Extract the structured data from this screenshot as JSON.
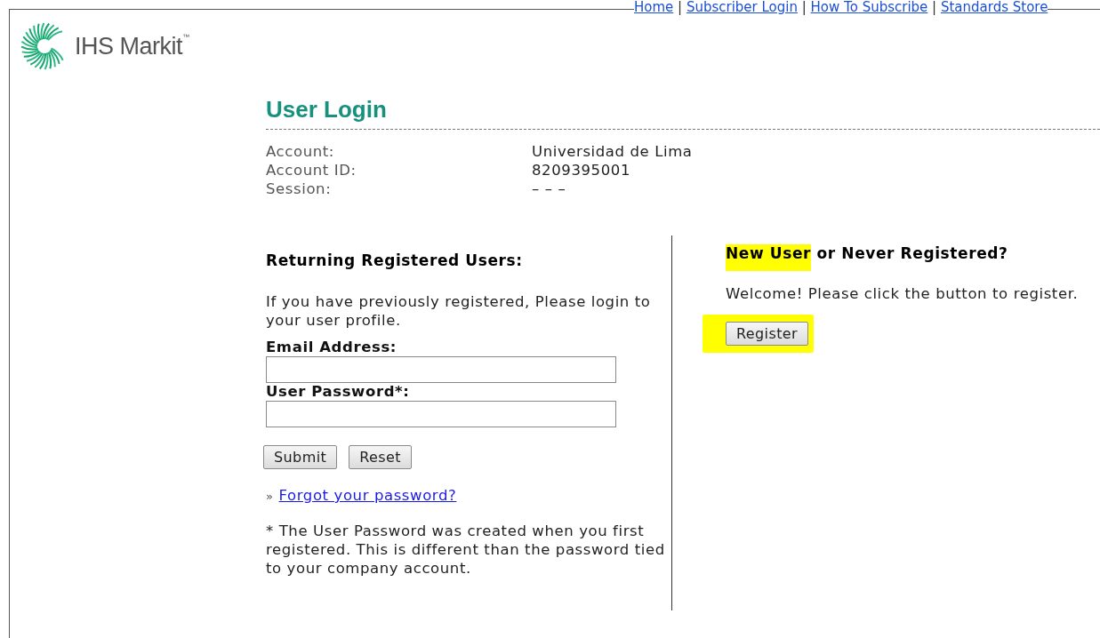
{
  "top_nav": {
    "links": [
      "Home",
      "Subscriber Login",
      "How To Subscribe",
      "Standards Store"
    ],
    "separator": "|"
  },
  "logo": {
    "text": "IHS Markit",
    "mark": "™"
  },
  "title": "User Login",
  "account_info": [
    {
      "label": "Account:",
      "value": "Universidad de Lima"
    },
    {
      "label": "Account ID:",
      "value": "8209395001"
    },
    {
      "label": "Session:",
      "value": "– – –"
    }
  ],
  "returning": {
    "heading": "Returning Registered Users:",
    "intro": "If you have previously registered, Please login to your user profile.",
    "fields": [
      {
        "label": "Email Address:"
      },
      {
        "label": "User Password*:"
      }
    ],
    "buttons": [
      "Submit",
      "Reset"
    ],
    "forgot_prefix": "»",
    "forgot_link": "Forgot your password?",
    "note": "* The User Password was created when you first registered. This is different than the password tied to your company account."
  },
  "new_user": {
    "heading_highlighted": "New User",
    "heading_rest": "or Never Registered?",
    "highlighted": true,
    "text": "Welcome! Please click the button to register.",
    "button": "Register",
    "button_highlighted": true
  }
}
